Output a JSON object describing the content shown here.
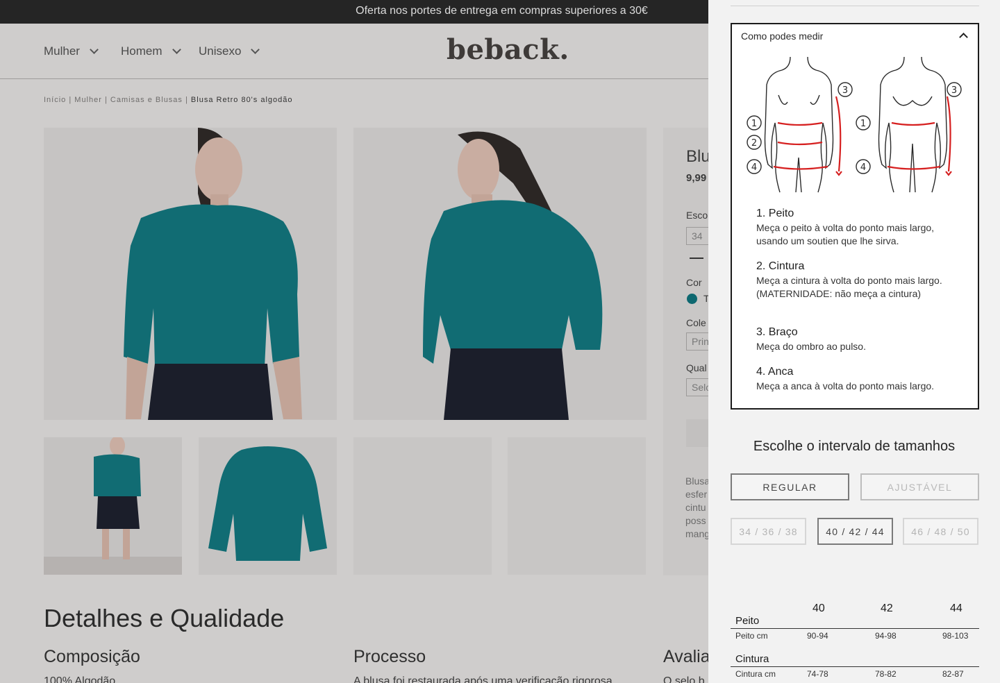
{
  "promo": {
    "text": "Oferta nos portes de entrega em compras superiores a 30€"
  },
  "nav": {
    "items": [
      {
        "label": "Mulher"
      },
      {
        "label": "Homem"
      },
      {
        "label": "Unisexo"
      }
    ],
    "logo": "beback."
  },
  "breadcrumb": {
    "home": "Início",
    "sep1": " | ",
    "category": "Mulher",
    "sep2": " | ",
    "subcategory": "Camisas e Blusas",
    "sep3": " | ",
    "current": "Blusa Retro 80's algodão"
  },
  "product_side": {
    "title_partial": "Blu",
    "price_partial": "9,99",
    "size_label_partial": "Esco",
    "size_value_partial": "34",
    "color_label": "Cor",
    "color_value_partial": "T",
    "color_swatch": "#0e6870",
    "collection_label_partial": "Cole",
    "collection_value_partial": "Prin",
    "quality_label_partial": "Qual",
    "quality_value_partial": "Selc",
    "desc_lines_partial": [
      "Blusa",
      "esfer",
      "cintu",
      "poss",
      "mang"
    ]
  },
  "details": {
    "title": "Detalhes e Qualidade",
    "composition_title": "Composição",
    "composition_text_partial": "100% Algodão",
    "process_title": "Processo",
    "process_text_partial": "A blusa foi restaurada após uma verificação rigorosa",
    "rating_title_partial": "Avalia",
    "rating_text_partial": "O selo b"
  },
  "panel": {
    "measure_title": "Como podes medir",
    "steps": [
      {
        "heading": "1. Peito",
        "desc": "Meça o peito à volta do ponto mais largo, usando um soutien que lhe sirva."
      },
      {
        "heading": "2. Cintura",
        "desc": "Meça a cintura à volta do ponto mais largo. (MATERNIDADE: não meça a cintura)"
      },
      {
        "heading": "3. Braço",
        "desc": "Meça do ombro ao pulso."
      },
      {
        "heading": "4. Anca",
        "desc": "Meça a anca à volta do ponto mais largo."
      }
    ],
    "range_title": "Escolhe o intervalo de tamanhos",
    "fit_options": [
      {
        "label": "REGULAR",
        "active": true
      },
      {
        "label": "AJUSTÁVEL",
        "active": false
      }
    ],
    "size_ranges": [
      {
        "label": "34 / 36 / 38",
        "active": false
      },
      {
        "label": "40 / 42 / 44",
        "active": true
      },
      {
        "label": "46 / 48 / 50",
        "active": false
      }
    ],
    "size_table": {
      "columns": [
        "40",
        "42",
        "44"
      ],
      "groups": [
        {
          "name": "Peito",
          "row_label": "Peito cm",
          "values": [
            "90-94",
            "94-98",
            "98-103"
          ]
        },
        {
          "name": "Cintura",
          "row_label": "Cintura cm",
          "values": [
            "74-78",
            "78-82",
            "82-87"
          ]
        }
      ]
    },
    "marker_color": "#d62020"
  }
}
